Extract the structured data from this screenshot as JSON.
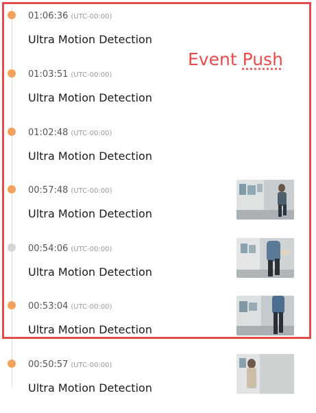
{
  "annotation": {
    "label_word_1": "Event",
    "label_word_2": "Push",
    "color": "#e54b4b"
  },
  "colors": {
    "dot_active": "#f4a25b",
    "dot_inactive": "#d5d5d5",
    "timeline": "#dcdcdc"
  },
  "events": [
    {
      "time": "01:06:36",
      "timezone": "(UTC-00:00)",
      "title": "Ultra Motion Detection",
      "dot": "active",
      "thumbnail": false
    },
    {
      "time": "01:03:51",
      "timezone": "(UTC-00:00)",
      "title": "Ultra Motion Detection",
      "dot": "active",
      "thumbnail": false
    },
    {
      "time": "01:02:48",
      "timezone": "(UTC-00:00)",
      "title": "Ultra Motion Detection",
      "dot": "active",
      "thumbnail": false
    },
    {
      "time": "00:57:48",
      "timezone": "(UTC-00:00)",
      "title": "Ultra Motion Detection",
      "dot": "active",
      "thumbnail": true
    },
    {
      "time": "00:54:06",
      "timezone": "(UTC-00:00)",
      "title": "Ultra Motion Detection",
      "dot": "inactive",
      "thumbnail": true
    },
    {
      "time": "00:53:04",
      "timezone": "(UTC-00:00)",
      "title": "Ultra Motion Detection",
      "dot": "active",
      "thumbnail": true
    },
    {
      "time": "00:50:57",
      "timezone": "(UTC-00:00)",
      "title": "Ultra Motion Detection",
      "dot": "active",
      "thumbnail": true
    }
  ]
}
